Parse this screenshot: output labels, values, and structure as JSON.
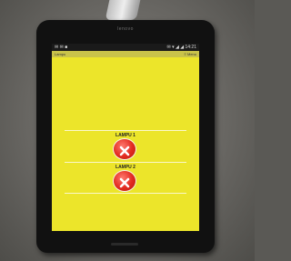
{
  "device": {
    "brand": "lenovo"
  },
  "status_bar": {
    "left_icons": "✉ ✉ ■",
    "right_text": "✉ ▾ ◢ ◢ 14:21"
  },
  "action_bar": {
    "title": "Lampu",
    "menu": "≡ Menu"
  },
  "lamps": [
    {
      "label": "LAMPU 1",
      "state_icon": "close-icon"
    },
    {
      "label": "LAMPU 2",
      "state_icon": "close-icon"
    }
  ],
  "colors": {
    "screen_background": "#ece52a",
    "button_red": "#e22a20"
  }
}
